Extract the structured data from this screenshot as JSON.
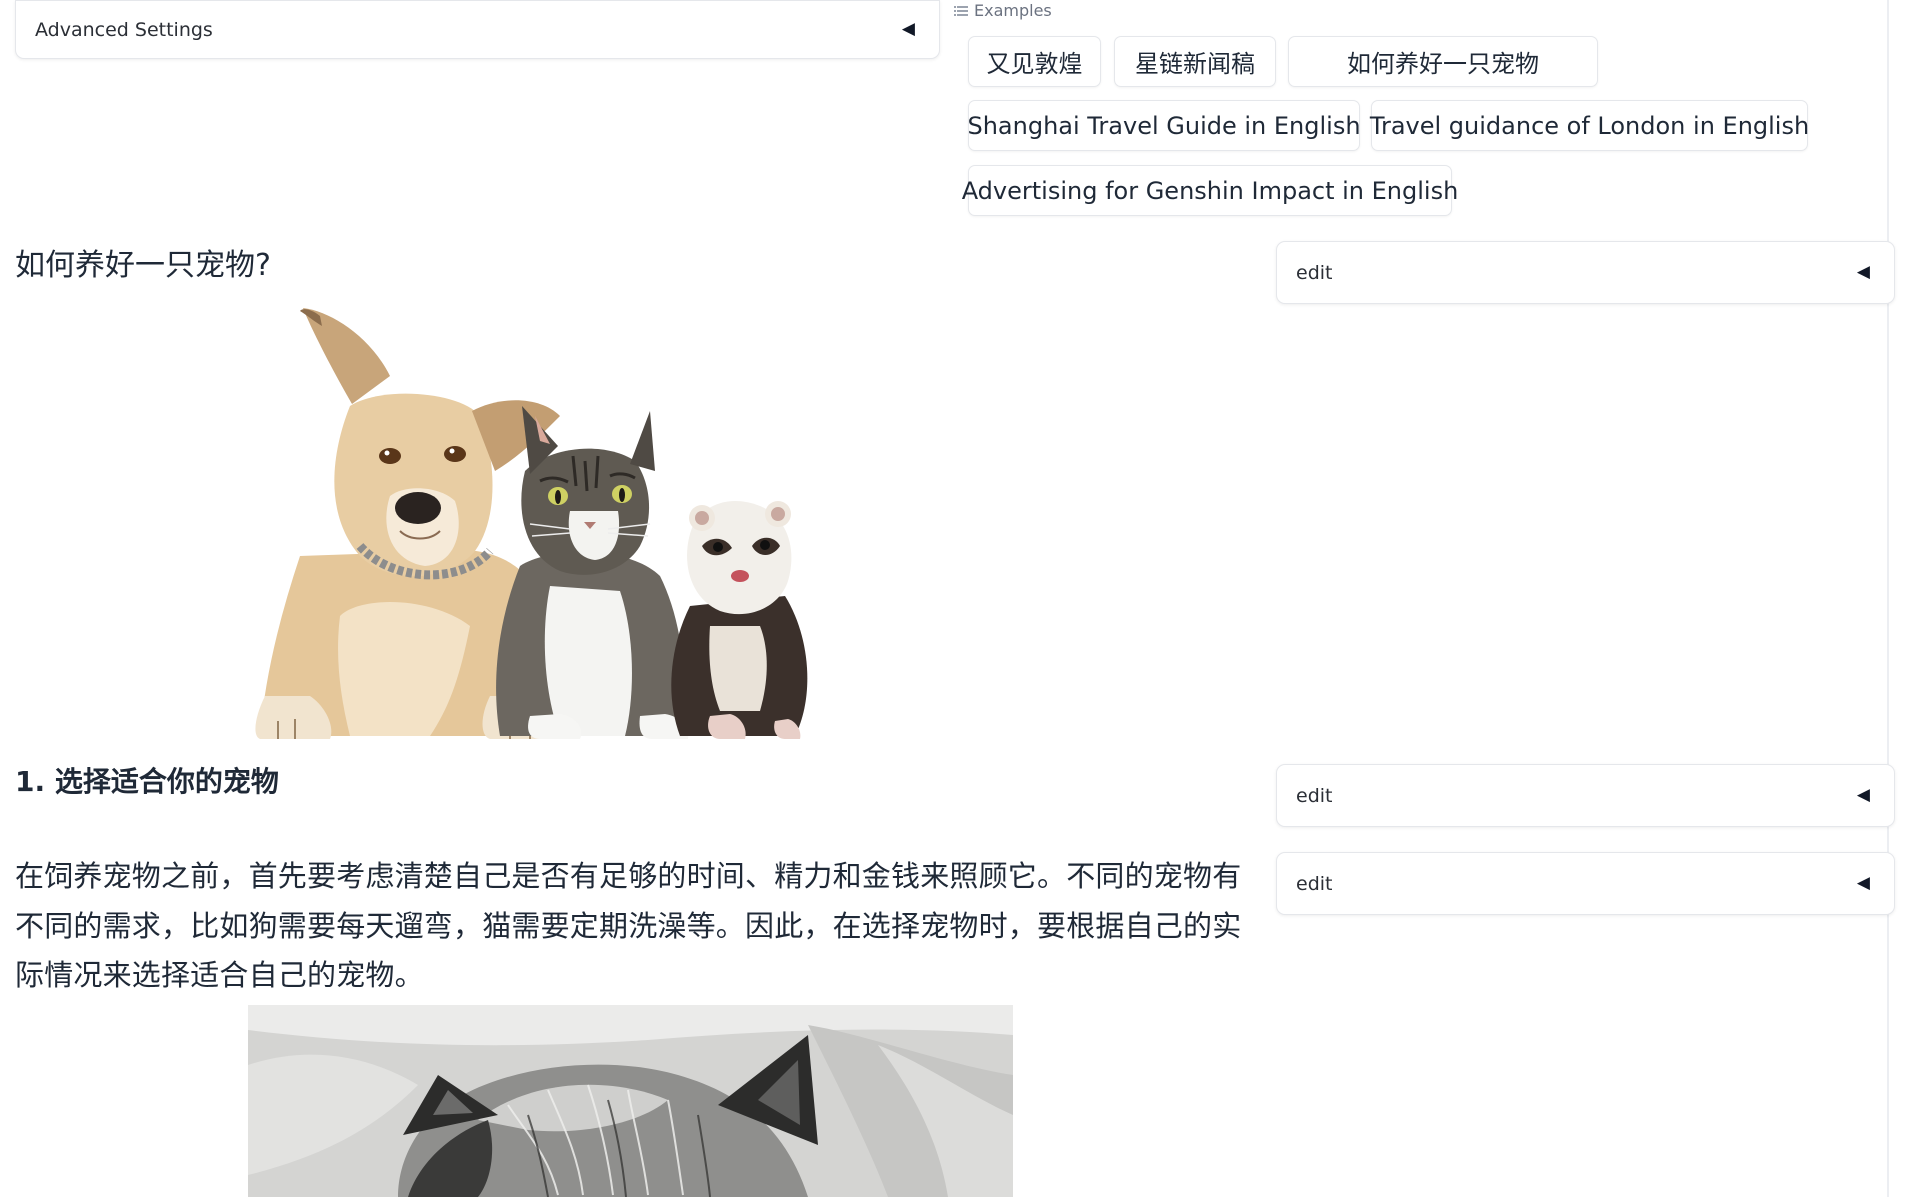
{
  "advanced_settings": {
    "label": "Advanced Settings",
    "arrow": "◀"
  },
  "examples": {
    "label": "Examples",
    "icon": "list-icon",
    "items": [
      "又见敦煌",
      "星链新闻稿",
      "如何养好一只宠物",
      "Shanghai Travel Guide in English",
      "Travel guidance of London in English",
      "Advertising for Genshin Impact in English"
    ]
  },
  "article": {
    "title": "如何养好一只宠物?",
    "section_1_heading": "1. 选择适合你的宠物",
    "section_1_paragraph": "在饲养宠物之前，首先要考虑清楚自己是否有足够的时间、精力和金钱来照顾它。不同的宠物有不同的需求，比如狗需要每天遛弯，猫需要定期洗澡等。因此，在选择宠物时，要根据自己的实际情况来选择适合自己的宠物。"
  },
  "edit_panels": [
    {
      "label": "edit",
      "arrow": "◀"
    },
    {
      "label": "edit",
      "arrow": "◀"
    },
    {
      "label": "edit",
      "arrow": "◀"
    }
  ]
}
